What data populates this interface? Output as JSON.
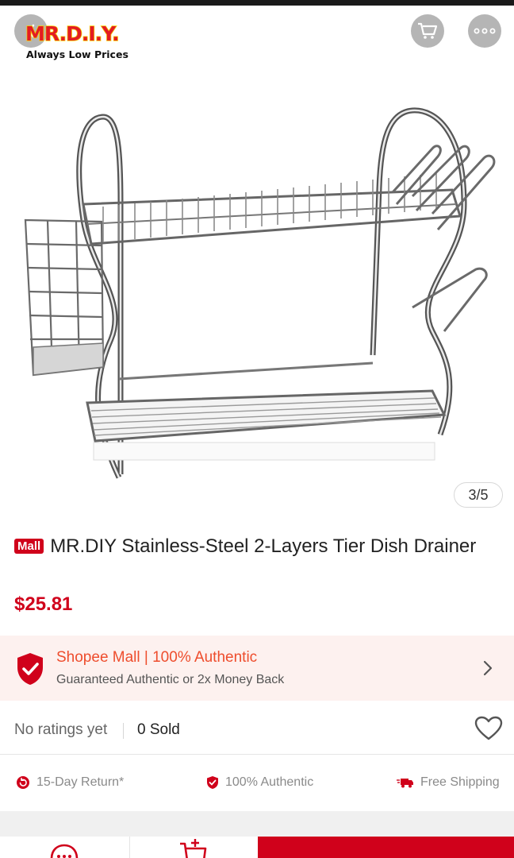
{
  "header": {
    "brand": {
      "name": "MR.D.I.Y.",
      "slogan": "Always Low Prices"
    },
    "icons": {
      "back": "back-arrow-icon",
      "cart": "shopping-cart-icon",
      "more": "more-dots-icon"
    }
  },
  "gallery": {
    "counter": "3/5"
  },
  "product": {
    "mall_badge": "Mall",
    "title": "MR.DIY Stainless-Steel 2-Layers Tier Dish Drainer",
    "price": "$25.81"
  },
  "mall_banner": {
    "headline": "Shopee Mall | 100% Authentic",
    "subline": "Guaranteed Authentic or 2x Money Back"
  },
  "stats": {
    "ratings": "No ratings yet",
    "sold": "0 Sold"
  },
  "badges": [
    {
      "label": "15-Day Return*",
      "icon": "return-icon"
    },
    {
      "label": "100% Authentic",
      "icon": "authentic-shield-icon"
    },
    {
      "label": "Free Shipping",
      "icon": "truck-icon"
    }
  ],
  "colors": {
    "brand_red": "#d0011b",
    "shopee_orange": "#ee4d2d",
    "banner_bg": "#fdf1ef"
  }
}
